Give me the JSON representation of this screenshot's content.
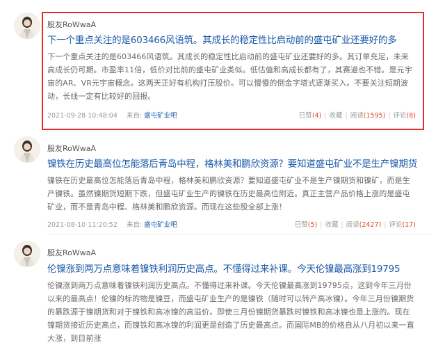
{
  "posts": [
    {
      "author": "股友RoWwaA",
      "title": "下一个重点关注的是603466风语筑。其成长的稳定性比启动前的盛屯矿业还要好的多",
      "body": "下一个重点关注的是603466风语筑。其成长的稳定性比启动前的盛屯矿业还要好的多。其订单充足，未来高成长仍可期。市盈率11倍，低价对比前的盛屯矿业类似。低估值和高成长都有了，其赛道也不错。是元宇宙的AR、VR元宇宙概念。这两天正好有机构打压股价。可以慢慢的倒金字塔式逐渐买入。不要关注短期波动，长线一定有比较好的回报。",
      "date": "2021-09-28 10:48:04",
      "source_label": "来自:",
      "source_link": "盛屯矿业吧",
      "likes_label": "已赞",
      "likes": "(4)",
      "fav_label": "收藏",
      "read_label": "阅读",
      "reads": "(1595)",
      "comment_label": "评论",
      "comments": "(8)"
    },
    {
      "author": "股友RoWwaA",
      "title": "镍铁在历史最高位怎能落后青岛中程，格林美和鹏欣资源？要知道盛屯矿业不是生产镍期货",
      "body": "镍铁在历史最高位怎能落后青岛中程，格林美和鹏欣资源？要知道盛屯矿业不是生产镍期货和镍矿，而是生产镍铁。虽然镍期货短期下跌，但盛屯矿业生产的镍铁在历史最高位附近。真正主营产品价格上涨的是盛屯矿业，而不是青岛中程、格林美和鹏欣资源。而现在这些股全部上涨！",
      "date": "2021-08-10 11:20:52",
      "source_label": "来自:",
      "source_link": "盛屯矿业吧",
      "likes_label": "已赞",
      "likes": "(5)",
      "fav_label": "收藏",
      "read_label": "阅读",
      "reads": "(2427)",
      "comment_label": "评论",
      "comments": "(17)"
    },
    {
      "author": "股友RoWwaA",
      "title": "伦镍涨到两万点意味着镍铁利润历史高点。不懂得过来补课。今天伦镍最高涨到19795",
      "body": "伦镍涨到两万点意味着镍铁利润历史高点。不懂得过来补课。今天伦镍最高涨到19795点，这到今年三月份以来的最高点！伦镍的标的物是镍豆，而盛屯矿业生产的是镍铁（随时可以转产高冰镍）。今年三月份镍期货的暴跌源于镍期货和对于镍铁和高冰镍的高溢价。即使三月份镍期货暴跌时镍铁和高冰镍也是上涨的。现在镍期货接近历史高点，而镍铁和高冰镍的利润更是创造了历史最高点。而国际MB的价格自从八月初以来一直大涨，到目前涨"
    }
  ]
}
